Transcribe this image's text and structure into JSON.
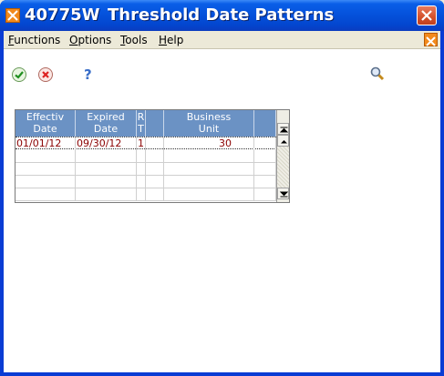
{
  "window": {
    "program_id": "40775W",
    "title": "Threshold Date Patterns",
    "colors": {
      "titlebar": "#0552dc",
      "grid_header": "#6b92c4",
      "row_text": "#8b0000"
    }
  },
  "menu": {
    "functions": {
      "mnemonic": "F",
      "rest": "unctions"
    },
    "options": {
      "mnemonic": "O",
      "rest": "ptions"
    },
    "tools": {
      "mnemonic": "T",
      "rest": "ools"
    },
    "help": {
      "mnemonic": "H",
      "rest": "elp"
    }
  },
  "toolbar": {
    "ok_icon": "green-checkmark-icon",
    "cancel_icon": "red-x-icon",
    "help_icon": "question-mark-icon",
    "find_icon": "magnifier-icon"
  },
  "grid": {
    "columns": [
      {
        "line1": "Effectiv",
        "line2": "Date"
      },
      {
        "line1": "Expired",
        "line2": "Date"
      },
      {
        "line1": "R",
        "line2": "T"
      },
      {
        "line1": "",
        "line2": ""
      },
      {
        "line1": "Business",
        "line2": "Unit"
      },
      {
        "line1": "",
        "line2": ""
      }
    ],
    "rows": [
      [
        "01/01/12",
        "09/30/12",
        "1",
        "",
        "30",
        ""
      ],
      [
        "",
        "",
        "",
        "",
        "",
        ""
      ],
      [
        "",
        "",
        "",
        "",
        "",
        ""
      ],
      [
        "",
        "",
        "",
        "",
        "",
        ""
      ],
      [
        "",
        "",
        "",
        "",
        "",
        ""
      ]
    ]
  }
}
